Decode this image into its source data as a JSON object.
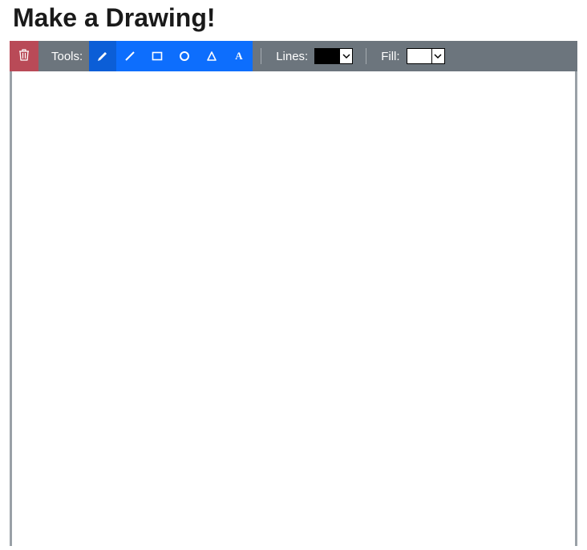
{
  "title": "Make a Drawing!",
  "toolbar": {
    "tools_label": "Tools:",
    "lines_label": "Lines:",
    "fill_label": "Fill:",
    "line_color": "#000000",
    "fill_color": "#ffffff",
    "tools": [
      {
        "name": "pencil",
        "active": true
      },
      {
        "name": "line",
        "active": false
      },
      {
        "name": "rectangle",
        "active": false
      },
      {
        "name": "circle",
        "active": false
      },
      {
        "name": "triangle",
        "active": false
      },
      {
        "name": "text",
        "active": false
      }
    ]
  }
}
